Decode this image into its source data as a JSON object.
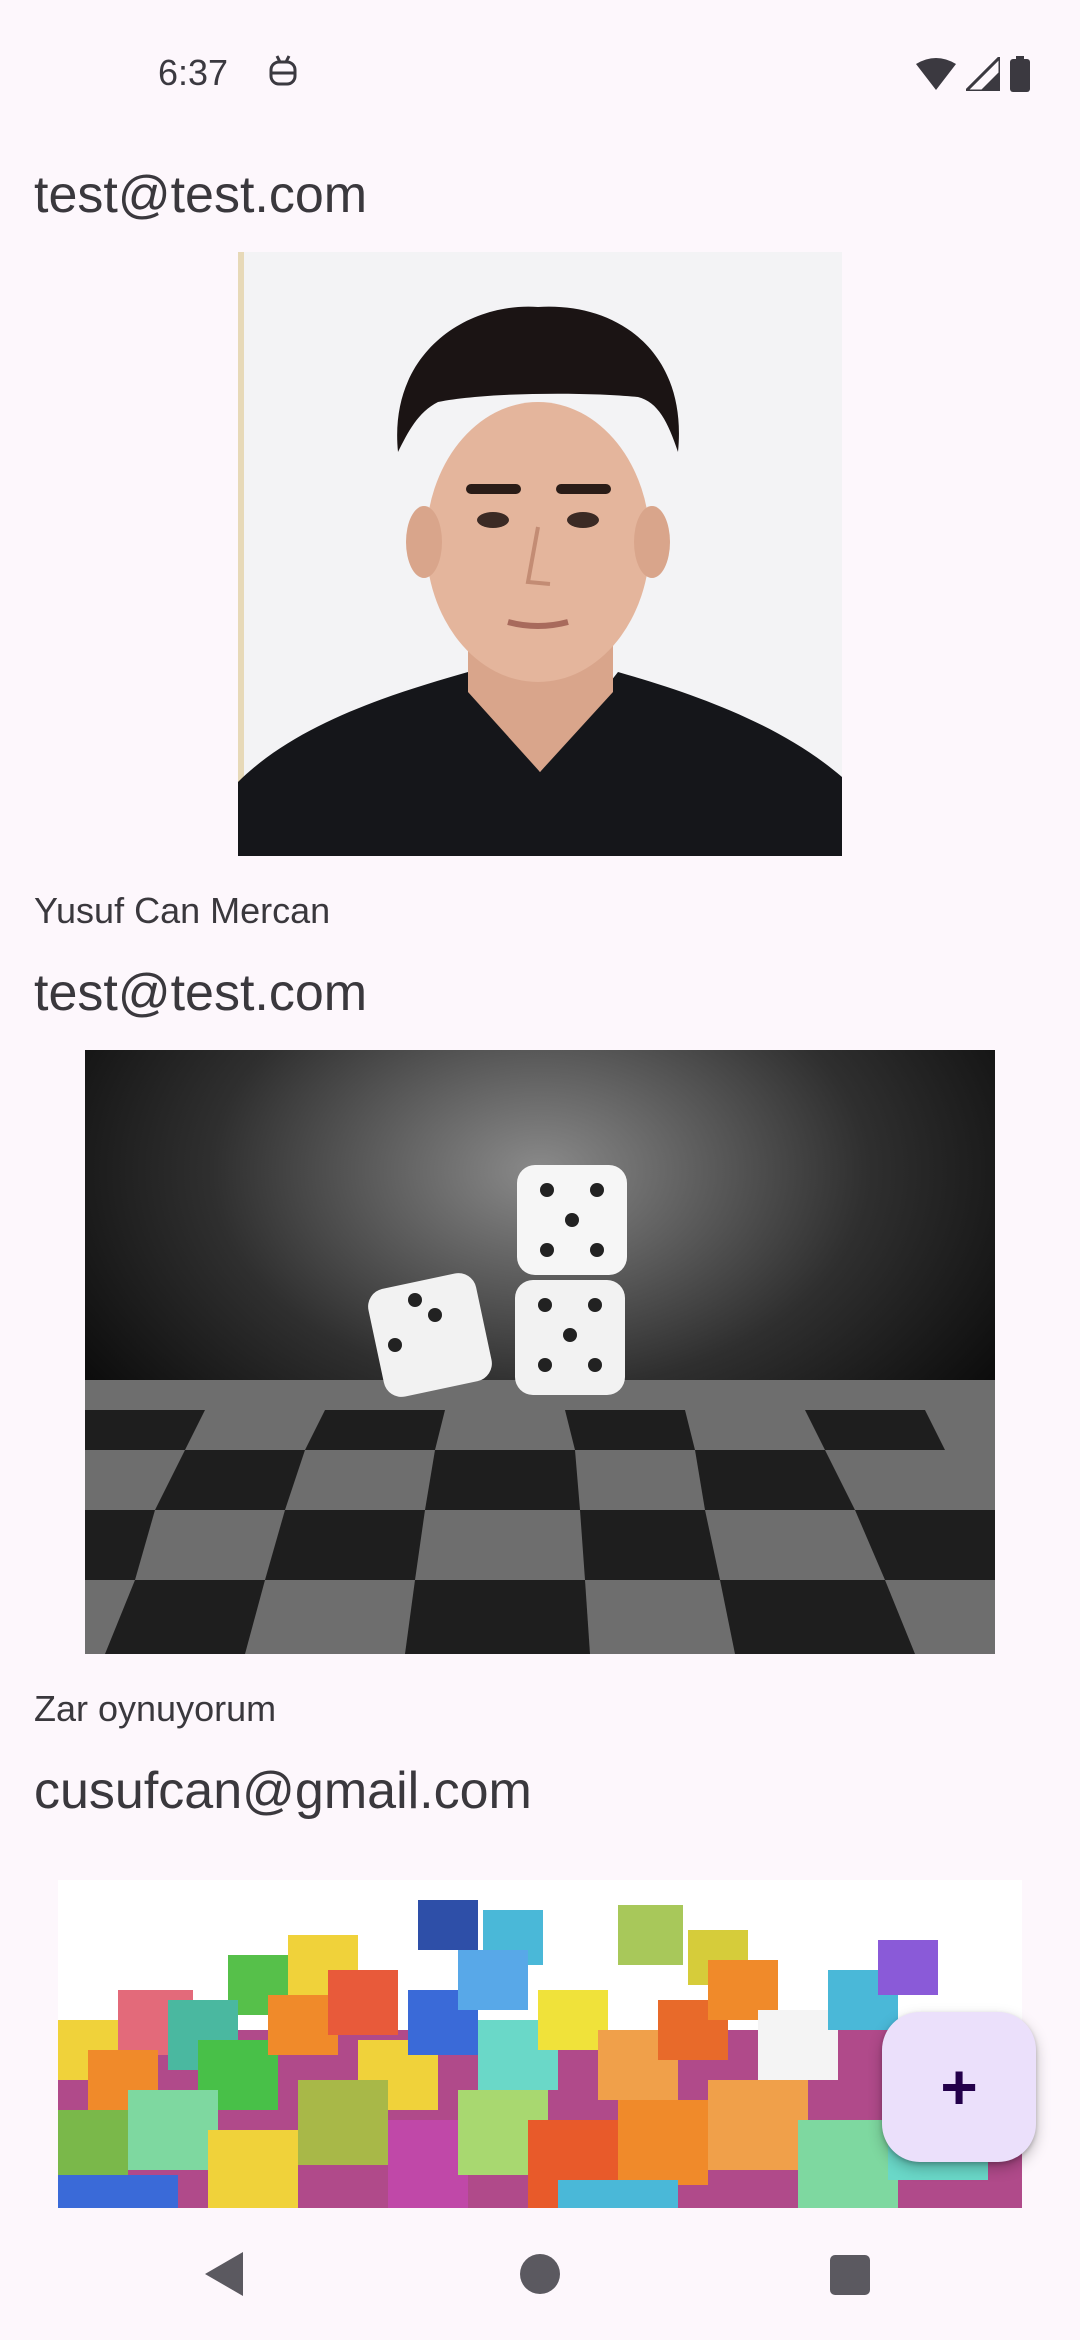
{
  "status_bar": {
    "time": "6:37",
    "notification_icon": "android-debug-icon",
    "wifi_icon": "wifi-icon",
    "signal_icon": "cell-signal-icon",
    "battery_icon": "battery-icon"
  },
  "posts": [
    {
      "email": "test@test.com",
      "image": "portrait-photo",
      "caption": "Yusuf Can Mercan"
    },
    {
      "email": "test@test.com",
      "image": "dice-on-chessboard-photo",
      "caption": "Zar oynuyorum"
    },
    {
      "email": "cusufcan@gmail.com",
      "image": "colorful-cubes-photo",
      "caption": ""
    }
  ],
  "fab": {
    "label": "+",
    "icon": "plus-icon"
  },
  "nav_bar": {
    "back_icon": "back-triangle-icon",
    "home_icon": "home-circle-icon",
    "recents_icon": "recents-square-icon"
  },
  "colors": {
    "background": "#fdf7fc",
    "fab_background": "#ebe0fb",
    "fab_icon": "#23004a",
    "text": "#3a383d"
  }
}
